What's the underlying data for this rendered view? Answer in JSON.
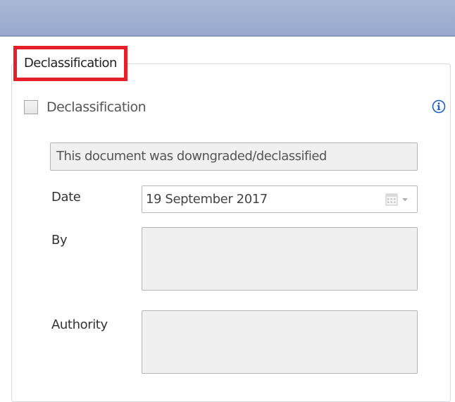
{
  "group": {
    "legend": "Declassification"
  },
  "checkbox": {
    "label": "Declassification",
    "checked": false
  },
  "info_icon": "info-icon",
  "status": {
    "text": "This document was downgraded/declassified"
  },
  "date": {
    "label": "Date",
    "value": "19 September 2017",
    "icon": "calendar-icon"
  },
  "by": {
    "label": "By",
    "value": ""
  },
  "authority": {
    "label": "Authority",
    "value": ""
  },
  "colors": {
    "title_bar": "#97a8cc",
    "highlight_border": "#e5202b",
    "info_icon": "#1d5fc9"
  }
}
